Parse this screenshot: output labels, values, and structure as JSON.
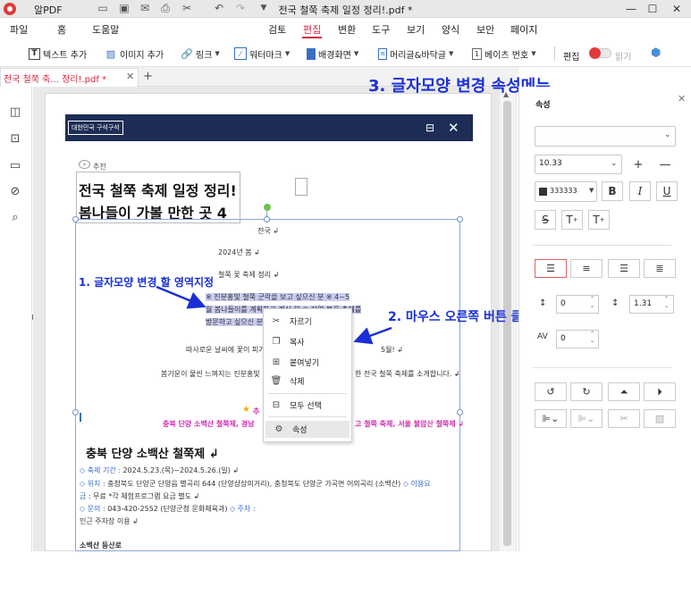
{
  "app": {
    "name": "알PDF",
    "window_title": "전국 철쭉 축제 일정 정리!.pdf *"
  },
  "menus": [
    "파일",
    "홈",
    "도움말",
    "검토",
    "편집",
    "변환",
    "도구",
    "보기",
    "양식",
    "보안",
    "페이지"
  ],
  "toolbar": {
    "add_text": "텍스트 추가",
    "add_image": "이미지 추가",
    "link": "링크",
    "watermark": "워터마크",
    "background": "배경화면",
    "header_footer": "머리글&바닥글",
    "bates": "베이츠 번호",
    "edit": "편집",
    "read": "읽기"
  },
  "tab": {
    "label": "전국 철쭉 축... 정리!.pdf *"
  },
  "document": {
    "header_badge": "대한민국 구석구석",
    "recommend": "추천",
    "title_line1": "전국 철쭉 축제 일정 정리!",
    "title_line2": "봄나들이 가볼 만한 곳 4",
    "p_nationwide": "전국 ↲",
    "p_year": "2024년 봄 ↲",
    "p_festival": "철쭉 꽃 축제 정리 ↲",
    "sel_line1": "※ 진분홍빛 철쭉 군락을 보고 싶으신 분 ※ 4~5",
    "sel_line2": "월 봄나들이를 계획하고 계신 분 ※ 지역 봄꽃 축제를",
    "sel_line3": "방문하고 싶으신 분",
    "p_warm": "따사로운 날씨에 꽃이 피기 시작",
    "p_warm_end": "5월! ↲",
    "p_spring": "봄기운이 물씬 느껴지는 진분홍빛",
    "p_spring_end": "한 전국 철쭉 축제를 소개합니다. ↲",
    "star_label": "추",
    "magenta_left": "충북 단양 소백산 철쭉제, 경남",
    "magenta_right": "고 철쭉 축제, 서울 불암산 철쭉제 ↲",
    "section_title": "충북 단양 소백산 철쭉제 ↲",
    "info1_label": "◇ 축제 기간 :",
    "info1_text": " 2024.5.23.(목)~2024.5.26.(일) ↲",
    "info2_label": "◇ 위치 :",
    "info2_text": " 충청북도 단양군 단양읍 별곡리 644 (단양상상의거리), 충청북도 단양군 가곡면 어의곡리 (소백산) ",
    "info2_extra": "◇ 이용요",
    "info3_label": "금",
    "info3_text": " : 무료 *각 체험프로그램 요금 별도 ↲",
    "info4_label": "◇ 문의 :",
    "info4_text": " 043-420-2552 (단양군청 문화체육과) ",
    "info4_extra": "◇ 주차 :",
    "info5_text": "인근 주차장 이용 ↲",
    "info6_text": "소백산 등산로"
  },
  "context_menu": {
    "cut": "자르기",
    "copy": "복사",
    "paste": "붙여넣기",
    "delete": "삭제",
    "select_all": "모두 선택",
    "properties": "속성"
  },
  "annotations": {
    "step1": "1. 글자모양 변경 할 영역지정",
    "step2": "2. 마우스 오른쪽 버튼 클릭",
    "step3": "3. 글자모양 변경 속성메뉴"
  },
  "properties_panel": {
    "title": "속성",
    "font_family": "",
    "font_size": "10.33",
    "color_hex": "333333",
    "char_spacing": "0",
    "line_spacing": "1.31",
    "para_spacing": "0"
  },
  "colors": {
    "accent": "#d7263d",
    "annotation": "#1a2fd6",
    "doc_header": "#1d2d55",
    "highlight": "#c9cdf0",
    "magenta": "#d22fb3",
    "text_color": "#333333"
  }
}
